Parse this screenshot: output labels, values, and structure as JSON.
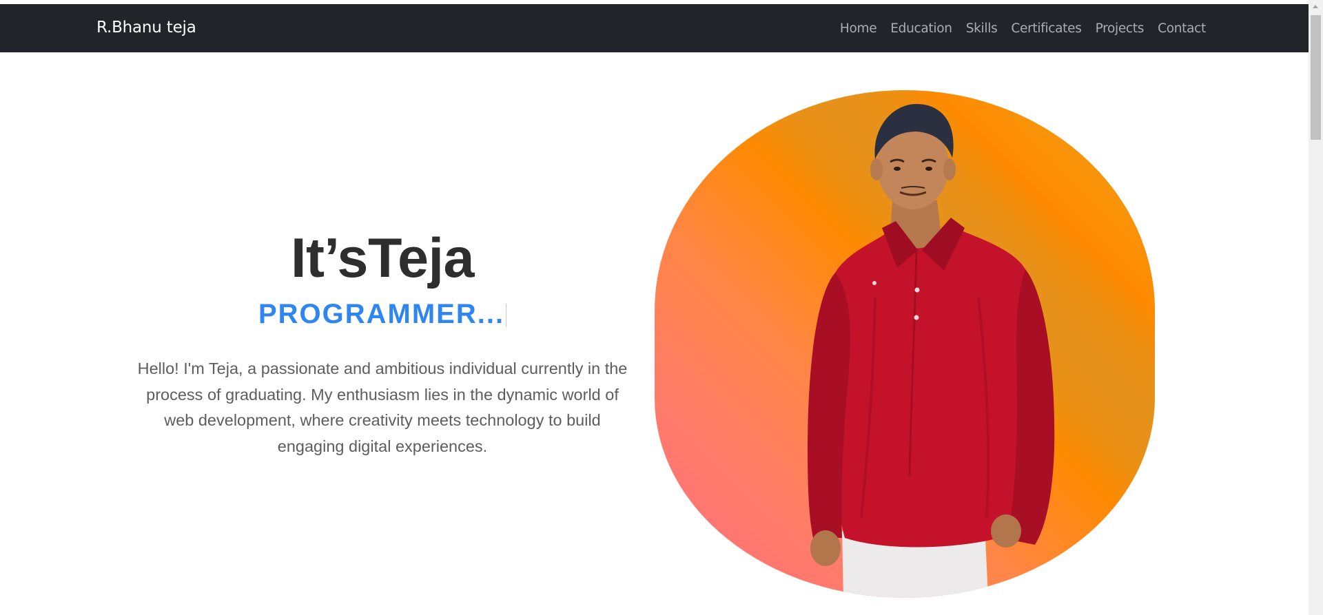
{
  "nav": {
    "brand": "R.Bhanu teja",
    "links": [
      {
        "label": "Home"
      },
      {
        "label": "Education"
      },
      {
        "label": "Skills"
      },
      {
        "label": "Certificates"
      },
      {
        "label": "Projects"
      },
      {
        "label": "Contact"
      }
    ]
  },
  "hero": {
    "title": "It’sTeja",
    "role": "PROGRAMMER...",
    "description": "Hello! I'm Teja, a passionate and ambitious individual currently in the process of graduating. My enthusiasm lies in the dynamic world of web development, where creativity meets technology to build engaging digital experiences."
  },
  "colors": {
    "navbar_bg": "#212529",
    "accent": "#2e86ee",
    "title": "#2e2e2e",
    "text": "#5d5d5d"
  }
}
